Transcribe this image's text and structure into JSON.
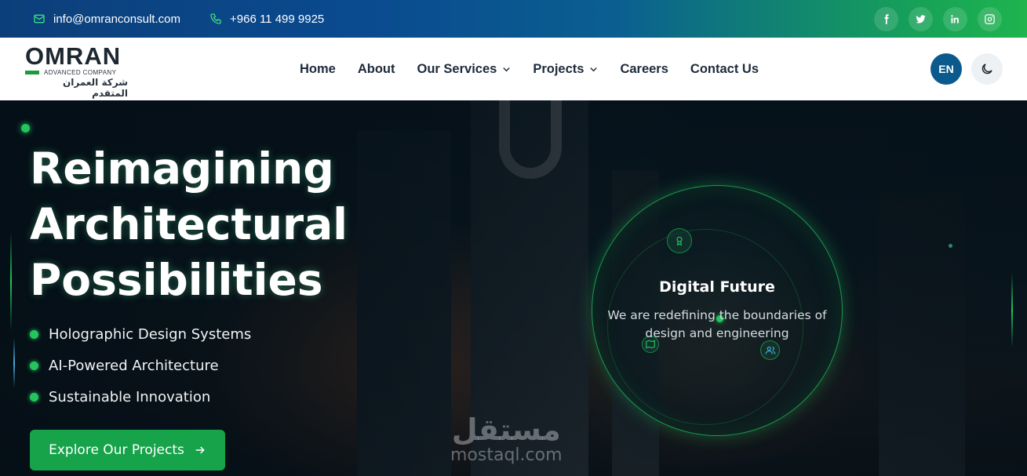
{
  "topbar": {
    "email": "info@omranconsult.com",
    "phone": "+966 11 499 9925",
    "socials": [
      "facebook-icon",
      "twitter-icon",
      "linkedin-icon",
      "instagram-icon"
    ]
  },
  "header": {
    "logo": {
      "name": "OMRAN",
      "sub": "ADVANCED COMPANY",
      "arabic": "شركة العمران المتقدم"
    },
    "nav": [
      {
        "label": "Home",
        "dropdown": false
      },
      {
        "label": "About",
        "dropdown": false
      },
      {
        "label": "Our Services",
        "dropdown": true
      },
      {
        "label": "Projects",
        "dropdown": true
      },
      {
        "label": "Careers",
        "dropdown": false
      },
      {
        "label": "Contact Us",
        "dropdown": false
      }
    ],
    "language": "EN",
    "theme_icon": "moon-icon"
  },
  "hero": {
    "title_lines": [
      "Reimagining",
      "Architectural",
      "Possibilities"
    ],
    "features": [
      "Holographic Design Systems",
      "AI-Powered Architecture",
      "Sustainable Innovation"
    ],
    "cta": "Explore Our Projects",
    "circle": {
      "title": "Digital Future",
      "text": "We are redefining the boundaries of design and engineering"
    },
    "watermark": {
      "arabic": "مستقل",
      "latin": "mostaql.com"
    }
  },
  "colors": {
    "accent_green": "#16a34a",
    "glow_green": "#22c55e",
    "brand_blue": "#0b5a8d",
    "nav_text": "#1d2b3b"
  }
}
